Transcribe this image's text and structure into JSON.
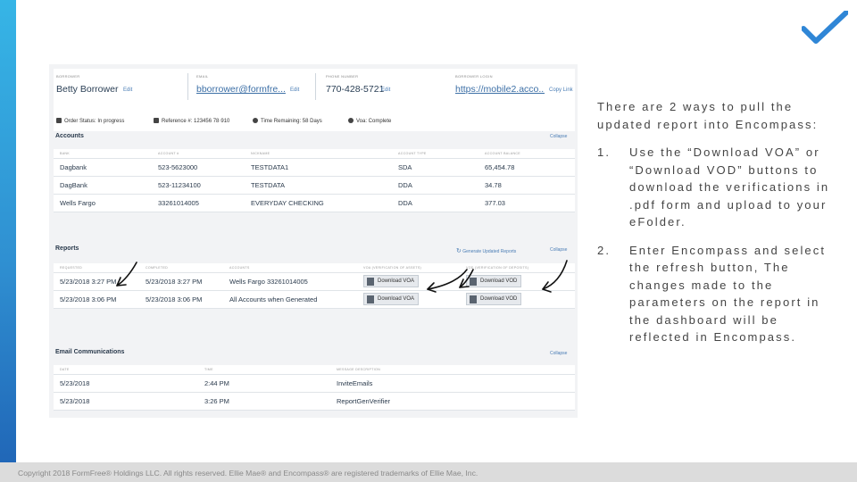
{
  "colors": {
    "accent_bar": "#2f8fd1",
    "checkmark": "#2f86d6",
    "footer_bg": "#dcdcdc"
  },
  "logo": {
    "icon": "checkmark-icon"
  },
  "borrower": {
    "borrower_label": "BORROWER",
    "borrower_value": "Betty Borrower",
    "email_label": "EMAIL",
    "email_value": "bborrower@formfre...",
    "phone_label": "PHONE NUMBER",
    "phone_value": "770-428-5721",
    "login_label": "BORROWER LOGIN",
    "login_value": "https://mobile2.acco...",
    "edit_label": "Edit",
    "copy_link_label": "Copy Link"
  },
  "status_bar": {
    "order_status": "Order Status: In progress",
    "reference": "Reference #: 123456 78·910",
    "time_remaining": "Time Remaining: 58 Days",
    "voa_complete": "Voa: Complete"
  },
  "accounts": {
    "title": "Accounts",
    "collapse_label": "Collapse",
    "headers": [
      "BANK",
      "ACCOUNT #",
      "NICKNAME",
      "ACCOUNT TYPE",
      "ACCOUNT BALANCE"
    ],
    "rows": [
      [
        "Dagbank",
        "523-5623000",
        "TESTDATA1",
        "SDA",
        "65,454.78"
      ],
      [
        "DagBank",
        "523-11234100",
        "TESTDATA",
        "DDA",
        "34.78"
      ],
      [
        "Wells Fargo",
        "33261014005",
        "EVERYDAY CHECKING",
        "DDA",
        "377.03"
      ]
    ]
  },
  "reports": {
    "title": "Reports",
    "generate_label": "Generate Updated Reports",
    "collapse_label": "Collapse",
    "headers": [
      "REQUESTED",
      "COMPLETED",
      "ACCOUNTS",
      "VOA (VERIFICATION OF ASSETS)",
      "VOD (VERIFICATION OF DEPOSITS)"
    ],
    "rows": [
      [
        "5/23/2018 3:27 PM",
        "5/23/2018 3:27 PM",
        "Wells Fargo 33261014005",
        "Download VOA",
        "Download VOD"
      ],
      [
        "5/23/2018 3:06 PM",
        "5/23/2018 3:06 PM",
        "All Accounts when Generated",
        "Download VOA",
        "Download VOD"
      ]
    ]
  },
  "email": {
    "title": "Email Communications",
    "collapse_label": "Collapse",
    "headers": [
      "DATE",
      "TIME",
      "MESSAGE DESCRIPTION"
    ],
    "rows": [
      [
        "5/23/2018",
        "2:44 PM",
        "InviteEmails"
      ],
      [
        "5/23/2018",
        "3:26 PM",
        "ReportGenVerifier"
      ]
    ]
  },
  "instructions": {
    "intro": "There are 2 ways to pull the updated report into Encompass:",
    "steps": [
      {
        "num": "1.",
        "text": "Use the “Download VOA” or “Download VOD” buttons to download the verifications in .pdf form and upload to your eFolder."
      },
      {
        "num": "2.",
        "text": "Enter Encompass and select the refresh button, The changes made to the parameters on the report in the dashboard will be reflected in Encompass."
      }
    ]
  },
  "footer": {
    "copyright": "Copyright 2018 FormFree® Holdings LLC. All rights reserved. Ellie Mae® and Encompass® are registered trademarks of Ellie Mae, Inc."
  }
}
